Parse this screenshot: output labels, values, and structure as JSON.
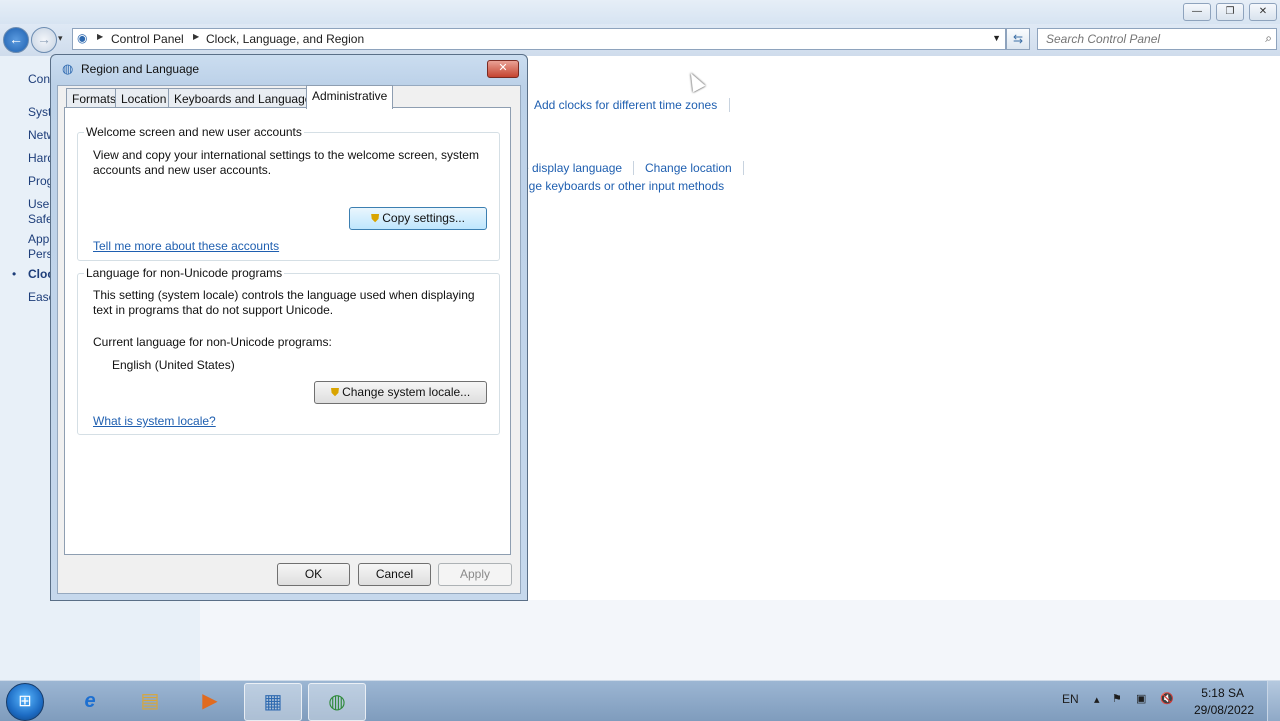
{
  "explorer": {
    "window_controls": {
      "minimize": "—",
      "maximize": "❐",
      "close": "✕"
    },
    "nav": {
      "back": "←",
      "forward": "→",
      "history": "▾"
    },
    "breadcrumb": [
      "Control Panel",
      "Clock, Language, and Region"
    ],
    "search": {
      "placeholder": "Search Control Panel"
    },
    "sidebar": [
      "Con",
      "Syst",
      "Netw",
      "Hard",
      "Prog",
      "User",
      "Safe",
      "App",
      "Pers",
      "Cloc",
      "Ease"
    ],
    "sidebar_bullet": "•",
    "links": {
      "add_clocks": "Add clocks for different time zones",
      "display_language": "e display language",
      "change_location": "Change location",
      "change_keyboards": "nge keyboards or other input methods"
    }
  },
  "dialog": {
    "title": "Region and Language",
    "close": "✕",
    "tabs": [
      "Formats",
      "Location",
      "Keyboards and Languages",
      "Administrative"
    ],
    "welcome": {
      "title": "Welcome screen and new user accounts",
      "description_line1": "View and copy your international settings to the welcome screen, system",
      "description_line2": "accounts and new user accounts.",
      "button": "Copy settings...",
      "link": "Tell me more about these accounts"
    },
    "unicode": {
      "title": "Language for non-Unicode programs",
      "description_line1": "This setting (system locale) controls the language used when displaying",
      "description_line2": "text in programs that do not support Unicode.",
      "current_label": "Current language for non-Unicode programs:",
      "current_value": "English (United States)",
      "button": "Change system locale...",
      "link": "What is system locale?"
    },
    "buttons": {
      "ok": "OK",
      "cancel": "Cancel",
      "apply": "Apply"
    }
  },
  "taskbar": {
    "start": "⊞",
    "apps": [
      "e",
      "▤",
      "▶",
      "▦",
      "◍"
    ],
    "language": "EN",
    "tray_icons": [
      "▴",
      "⚑",
      "▣",
      "🔇"
    ],
    "time": "5:18 SA",
    "date": "29/08/2022"
  },
  "colors": {
    "link": "#1f5fb0",
    "taskbar": "#8fa9c7",
    "dialog_frame": "#c6d8ec"
  }
}
